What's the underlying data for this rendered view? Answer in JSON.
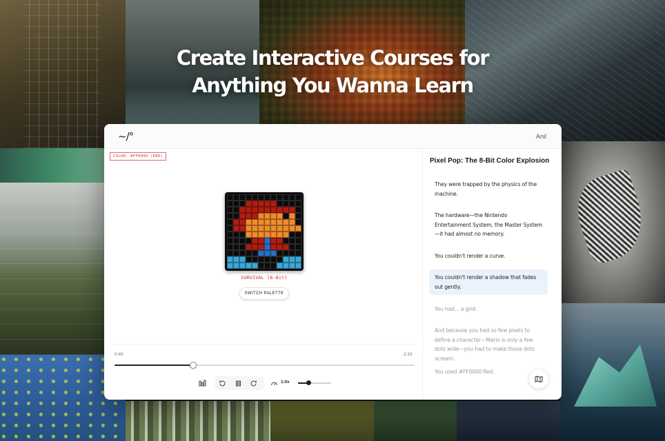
{
  "hero": {
    "line1": "Create Interactive Courses for",
    "line2": "Anything You Wanna Learn"
  },
  "app": {
    "logo": "~/°",
    "user": "Anil"
  },
  "stage": {
    "color_tag": "COLOR: #FF0000 (RED)",
    "mode_label": "SURVIVAL (8-Bit)",
    "switch_button": "SWITCH PALETTE",
    "sprite_palette": {
      "k": "#0b0b0b",
      "r": "#b21d12",
      "o": "#f08c2c",
      "c": "#3aa8d8",
      "b": "#2a6ec8"
    }
  },
  "player": {
    "current_time": "0:40",
    "total_time": "2:33",
    "progress_fraction": 0.263,
    "speed": "1.0x",
    "volume_fraction": 0.32,
    "icons": [
      "chart-icon",
      "rewind-icon",
      "pause-icon",
      "forward-icon",
      "speed-gauge-icon"
    ]
  },
  "transcript": {
    "title": "Pixel Pop: The 8-Bit Color Explosion",
    "lines": [
      {
        "text": "They were trapped by the physics of the machine.",
        "state": "normal"
      },
      {
        "text": "The hardware—the Nintendo Entertainment System, the Master System—it had almost no memory.",
        "state": "normal"
      },
      {
        "text": "You couldn't render a curve.",
        "state": "normal"
      },
      {
        "text": "You couldn't render a shadow that fades out gently.",
        "state": "active"
      },
      {
        "text": "You had... a grid.",
        "state": "dim"
      },
      {
        "text": "And because you had so few pixels to define a character—Mario is only a few dots wide—you had to make those dots scream.",
        "state": "dim"
      },
      {
        "text": "You used #FF0000 Red.",
        "state": "dim"
      }
    ],
    "map_icon": "map-icon"
  }
}
